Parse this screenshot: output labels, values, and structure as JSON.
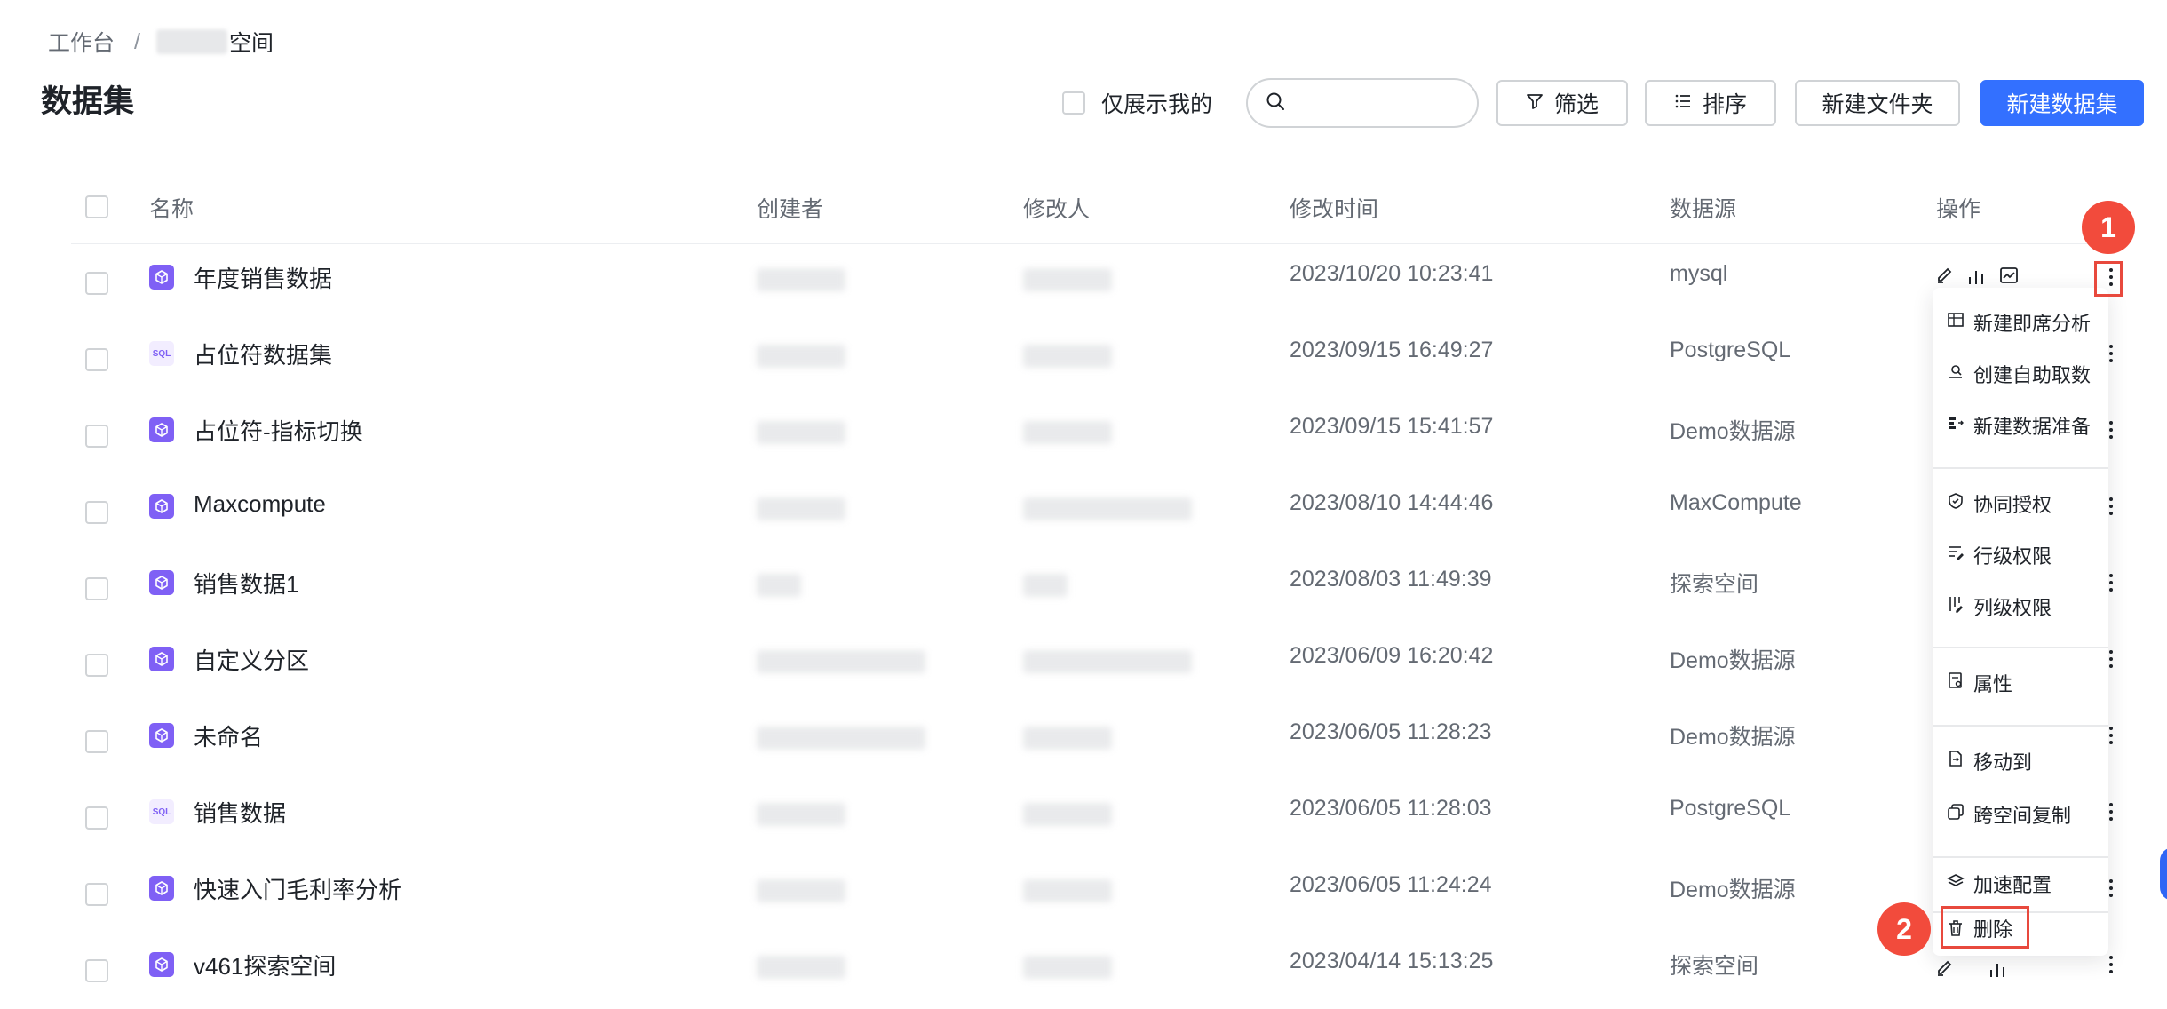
{
  "breadcrumb": {
    "root": "工作台",
    "separator": "/",
    "current": "空间"
  },
  "page_title": "数据集",
  "toolbar": {
    "only_mine_label": "仅展示我的",
    "search_placeholder": "",
    "filter_label": "筛选",
    "sort_label": "排序",
    "new_folder_label": "新建文件夹",
    "new_dataset_label": "新建数据集"
  },
  "table": {
    "headers": {
      "name": "名称",
      "creator": "创建者",
      "modifier": "修改人",
      "modified_time": "修改时间",
      "source": "数据源",
      "actions": "操作"
    },
    "rows": [
      {
        "name": "年度销售数据",
        "icon": "cube-icon",
        "time": "2023/10/20 10:23:41",
        "source": "mysql"
      },
      {
        "name": "占位符数据集",
        "icon": "sql-icon",
        "time": "2023/09/15 16:49:27",
        "source": "PostgreSQL"
      },
      {
        "name": "占位符-指标切换",
        "icon": "cube-icon",
        "time": "2023/09/15 15:41:57",
        "source": "Demo数据源"
      },
      {
        "name": "Maxcompute",
        "icon": "cube-icon",
        "time": "2023/08/10 14:44:46",
        "source": "MaxCompute"
      },
      {
        "name": "销售数据1",
        "icon": "cube-icon",
        "time": "2023/08/03 11:49:39",
        "source": "探索空间"
      },
      {
        "name": "自定义分区",
        "icon": "cube-icon",
        "time": "2023/06/09 16:20:42",
        "source": "Demo数据源"
      },
      {
        "name": "未命名",
        "icon": "cube-icon",
        "time": "2023/06/05 11:28:23",
        "source": "Demo数据源"
      },
      {
        "name": "销售数据",
        "icon": "sql-icon",
        "time": "2023/06/05 11:28:03",
        "source": "PostgreSQL"
      },
      {
        "name": "快速入门毛利率分析",
        "icon": "cube-icon",
        "time": "2023/06/05 11:24:24",
        "source": "Demo数据源"
      },
      {
        "name": "v461探索空间",
        "icon": "cube-icon",
        "time": "2023/04/14 15:13:25",
        "source": "探索空间"
      }
    ]
  },
  "sql_icon_text": "SQL",
  "menu": {
    "items": [
      {
        "label": "新建即席分析",
        "icon": "table-icon"
      },
      {
        "label": "创建自助取数",
        "icon": "search-data-icon"
      },
      {
        "label": "新建数据准备",
        "icon": "data-prep-icon"
      },
      {
        "label": "协同授权",
        "icon": "shield-icon"
      },
      {
        "label": "行级权限",
        "icon": "row-permission-icon"
      },
      {
        "label": "列级权限",
        "icon": "column-permission-icon"
      },
      {
        "label": "属性",
        "icon": "properties-icon"
      },
      {
        "label": "移动到",
        "icon": "move-icon"
      },
      {
        "label": "跨空间复制",
        "icon": "copy-icon"
      },
      {
        "label": "加速配置",
        "icon": "layers-icon"
      },
      {
        "label": "删除",
        "icon": "trash-icon"
      }
    ]
  },
  "callouts": {
    "first": "1",
    "second": "2"
  },
  "colors": {
    "primary": "#3370ff",
    "accent_purple": "#7f60f5",
    "callout_red": "#f24b3c"
  }
}
